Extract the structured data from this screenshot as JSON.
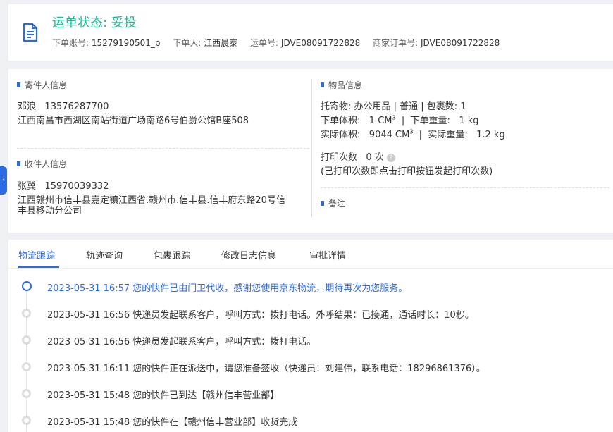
{
  "header": {
    "status_title": "运单状态: 妥投",
    "account_label": "下单账号:",
    "account_value": "15279190501_p",
    "orderer_label": "下单人:",
    "orderer_value": "江西晨泰",
    "waybill_label": "运单号:",
    "waybill_value": "JDVE08091722828",
    "merchant_label": "商家订单号:",
    "merchant_value": "JDVE08091722828"
  },
  "sender": {
    "title": "寄件人信息",
    "name": "邓浪",
    "phone": "13576287700",
    "address": "江西南昌市西湖区南站街道广场南路6号伯爵公馆B座508"
  },
  "receiver": {
    "title": "收件人信息",
    "name": "张冀",
    "phone": "15970039332",
    "address_line1": "江西赣州市信丰县嘉定镇江西省.赣州市.信丰县.信丰府东路20号信",
    "address_line2": "丰县移动分公司"
  },
  "goods": {
    "title": "物品信息",
    "line1": "托寄物:  办公用品 | 普通  |  包裹数:  1",
    "vol_label": "下单体积:",
    "vol_value": "1 CM",
    "weight_label": "下单重量:",
    "weight_value": "1 kg",
    "actual_vol_label": "实际体积:",
    "actual_vol_value": "9044 CM",
    "actual_weight_label": "实际重量:",
    "actual_weight_value": "1.2 kg",
    "sup": "3",
    "print_label": "打印次数",
    "print_value": "0 次",
    "print_note": "(已打印次数即点击打印按钮发起打印次数)"
  },
  "remarks": {
    "title": "备注"
  },
  "side_tab": {
    "glyph": "‹"
  },
  "tabs": [
    "物流跟踪",
    "轨迹查询",
    "包裹跟踪",
    "修改日志信息",
    "审批详情"
  ],
  "events": [
    "2023-05-31 16:57 您的快件已由门卫代收，感谢您使用京东物流，期待再次为您服务。",
    "2023-05-31 16:56 快递员发起联系客户，呼叫方式：拨打电话。外呼结果：已接通，通话时长：10秒。",
    "2023-05-31 16:56 快递员发起联系客户，呼叫方式：拨打电话。",
    "2023-05-31 16:11 您的快件正在派送中，请您准备签收（快递员：刘建伟，联系电话：18296861376）。",
    "2023-05-31 15:48 您的快件已到达【赣州信丰营业部】",
    "2023-05-31 15:48 您的快件在【赣州信丰营业部】收货完成"
  ],
  "colors": {
    "accent": "#2d6be4",
    "status": "#19be9b"
  }
}
